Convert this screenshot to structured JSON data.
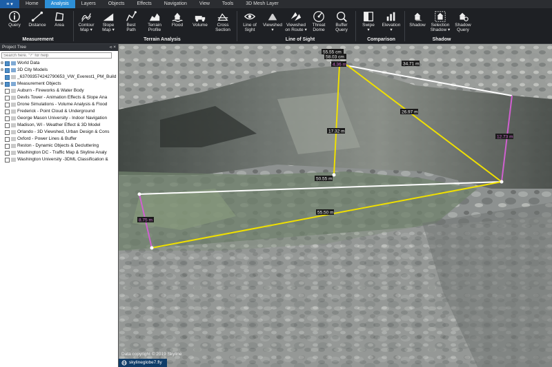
{
  "menubar": {
    "app_button": "≡",
    "tabs": [
      "Home",
      "Analysis",
      "Layers",
      "Objects",
      "Effects",
      "Navigation",
      "View",
      "Tools",
      "3D Mesh Layer"
    ],
    "active_tab": "Analysis"
  },
  "ribbon": {
    "buttons": [
      {
        "id": "query",
        "label": "Query",
        "icon": "info-icon"
      },
      {
        "id": "distance",
        "label": "Distance",
        "icon": "distance-icon"
      },
      {
        "id": "area",
        "label": "Area",
        "icon": "area-icon"
      },
      {
        "id": "contour",
        "label": "Contour\nMap ▾",
        "icon": "contour-icon"
      },
      {
        "id": "slope",
        "label": "Slope\nMap ▾",
        "icon": "slope-icon"
      },
      {
        "id": "bestpath",
        "label": "Best\nPath",
        "icon": "best-path-icon"
      },
      {
        "id": "terrainprofile",
        "label": "Terrain\nProfile",
        "icon": "terrain-profile-icon"
      },
      {
        "id": "flood",
        "label": "Flood",
        "icon": "flood-icon"
      },
      {
        "id": "volume",
        "label": "Volume",
        "icon": "volume-icon"
      },
      {
        "id": "crosssection",
        "label": "Cross\nSection",
        "icon": "cross-section-icon"
      },
      {
        "id": "lineofsight",
        "label": "Line of\nSight",
        "icon": "eye-icon"
      },
      {
        "id": "viewshed",
        "label": "Viewshed\n▾",
        "icon": "viewshed-icon"
      },
      {
        "id": "viewshedroute",
        "label": "Viewshed\non Route ▾",
        "icon": "viewshed-route-icon"
      },
      {
        "id": "threatdome",
        "label": "Threat\nDome",
        "icon": "threat-dome-icon"
      },
      {
        "id": "bufferquery",
        "label": "Buffer\nQuery",
        "icon": "buffer-query-icon"
      },
      {
        "id": "swipe",
        "label": "Swipe\n▾",
        "icon": "swipe-icon"
      },
      {
        "id": "elevation",
        "label": "Elevation\n▾",
        "icon": "elevation-icon"
      },
      {
        "id": "shadow",
        "label": "Shadow",
        "icon": "shadow-icon"
      },
      {
        "id": "selectionshadow",
        "label": "Selection\nShadow ▾",
        "icon": "selection-shadow-icon"
      },
      {
        "id": "shadowquery",
        "label": "Shadow\nQuery",
        "icon": "shadow-query-icon"
      }
    ],
    "groups": [
      "Measurement",
      "Terrain Analysis",
      "Line of Sight",
      "Comparison",
      "Shadow"
    ]
  },
  "panel": {
    "title": "Project Tree",
    "controls": "⪦ ×",
    "search_placeholder": "Search here. \"?\" for help",
    "items": [
      {
        "label": "World Data",
        "checked": true,
        "folder": true,
        "expander": "⊕"
      },
      {
        "label": "3D City Models",
        "checked": true,
        "folder": true,
        "expander": "⊕"
      },
      {
        "label": "_637093574242790653_VW_Everest1_PM_Build",
        "checked": true,
        "folder": false,
        "expander": ""
      },
      {
        "label": "Measurement Objects",
        "checked": true,
        "folder": true,
        "expander": "⊕"
      },
      {
        "label": "Auburn - Fireworks & Water Body",
        "checked": false,
        "folder": false,
        "expander": ""
      },
      {
        "label": "Devils Tower - Animation Effects & Slope Ana",
        "checked": false,
        "folder": false,
        "expander": ""
      },
      {
        "label": "Drone Simulations - Volume Analysis & Flood",
        "checked": false,
        "folder": false,
        "expander": ""
      },
      {
        "label": "Frederick - Point Cloud & Underground",
        "checked": false,
        "folder": false,
        "expander": ""
      },
      {
        "label": "George Mason University - Indoor Navigation",
        "checked": false,
        "folder": false,
        "expander": ""
      },
      {
        "label": "Madison, WI - Weather Effect & 3D Model",
        "checked": false,
        "folder": false,
        "expander": ""
      },
      {
        "label": "Orlando - 3D Viewshed, Urban Design & Cons",
        "checked": false,
        "folder": false,
        "expander": ""
      },
      {
        "label": "Oxford - Power Lines & Buffer",
        "checked": false,
        "folder": false,
        "expander": ""
      },
      {
        "label": "Reston - Dynamic Objects & Decluttering",
        "checked": false,
        "folder": false,
        "expander": ""
      },
      {
        "label": "Washington DC - Traffic Map & Skyline Analy",
        "checked": false,
        "folder": false,
        "expander": ""
      },
      {
        "label": "Washington University -3DML Classification &",
        "checked": false,
        "folder": false,
        "expander": ""
      }
    ]
  },
  "viewport": {
    "measurements": {
      "top_height_a": "55.55 cm",
      "top_height_b": "58.03 cm",
      "vertical_small": "4.36 m",
      "white_top": "34.71 m",
      "yellow_diag": "26.97 m",
      "vertical_mid": "17.32 m",
      "pink_right": "12.73 m",
      "white_mid": "50.55 m",
      "pink_left": "8.75 m",
      "yellow_bottom": "55.50 m"
    },
    "copyright": "Data copyright © 2019 Skyline",
    "file_tab": "skylineglobe7.fly"
  },
  "colors": {
    "accent": "#2d8fd6",
    "yellow_line": "#f0e000",
    "pink_line": "#d060d0",
    "white_line": "#ffffff",
    "label_bg": "#1b1b1b"
  }
}
